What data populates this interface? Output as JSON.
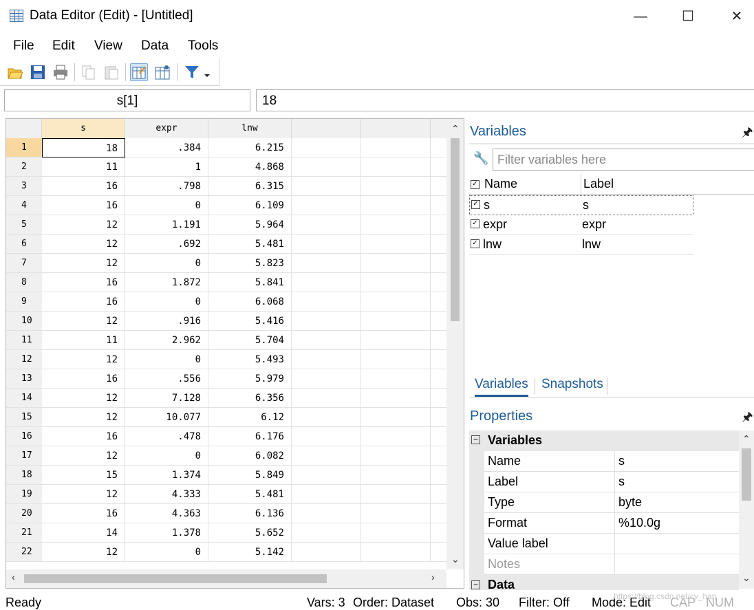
{
  "window": {
    "title": "Data Editor (Edit) - [Untitled]"
  },
  "menu": [
    "File",
    "Edit",
    "View",
    "Data",
    "Tools"
  ],
  "cell_ref": "s[1]",
  "cell_value": "18",
  "grid": {
    "columns": [
      "s",
      "expr",
      "lnw"
    ],
    "rows": [
      {
        "n": "1",
        "s": "18",
        "expr": ".384",
        "lnw": "6.215"
      },
      {
        "n": "2",
        "s": "11",
        "expr": "1",
        "lnw": "4.868"
      },
      {
        "n": "3",
        "s": "16",
        "expr": ".798",
        "lnw": "6.315"
      },
      {
        "n": "4",
        "s": "16",
        "expr": "0",
        "lnw": "6.109"
      },
      {
        "n": "5",
        "s": "12",
        "expr": "1.191",
        "lnw": "5.964"
      },
      {
        "n": "6",
        "s": "12",
        "expr": ".692",
        "lnw": "5.481"
      },
      {
        "n": "7",
        "s": "12",
        "expr": "0",
        "lnw": "5.823"
      },
      {
        "n": "8",
        "s": "16",
        "expr": "1.872",
        "lnw": "5.841"
      },
      {
        "n": "9",
        "s": "16",
        "expr": "0",
        "lnw": "6.068"
      },
      {
        "n": "10",
        "s": "12",
        "expr": ".916",
        "lnw": "5.416"
      },
      {
        "n": "11",
        "s": "11",
        "expr": "2.962",
        "lnw": "5.704"
      },
      {
        "n": "12",
        "s": "12",
        "expr": "0",
        "lnw": "5.493"
      },
      {
        "n": "13",
        "s": "16",
        "expr": ".556",
        "lnw": "5.979"
      },
      {
        "n": "14",
        "s": "12",
        "expr": "7.128",
        "lnw": "6.356"
      },
      {
        "n": "15",
        "s": "12",
        "expr": "10.077",
        "lnw": "6.12"
      },
      {
        "n": "16",
        "s": "16",
        "expr": ".478",
        "lnw": "6.176"
      },
      {
        "n": "17",
        "s": "12",
        "expr": "0",
        "lnw": "6.082"
      },
      {
        "n": "18",
        "s": "15",
        "expr": "1.374",
        "lnw": "5.849"
      },
      {
        "n": "19",
        "s": "12",
        "expr": "4.333",
        "lnw": "5.481"
      },
      {
        "n": "20",
        "s": "16",
        "expr": "4.363",
        "lnw": "6.136"
      },
      {
        "n": "21",
        "s": "14",
        "expr": "1.378",
        "lnw": "5.652"
      },
      {
        "n": "22",
        "s": "12",
        "expr": "0",
        "lnw": "5.142"
      }
    ]
  },
  "variables_pane": {
    "title": "Variables",
    "filter_placeholder": "Filter variables here",
    "headers": {
      "name": "Name",
      "label": "Label"
    },
    "items": [
      {
        "name": "s",
        "label": "s"
      },
      {
        "name": "expr",
        "label": "expr"
      },
      {
        "name": "lnw",
        "label": "lnw"
      }
    ]
  },
  "tabs": [
    "Variables",
    "Snapshots"
  ],
  "properties_pane": {
    "title": "Properties",
    "section": "Variables",
    "rows": [
      {
        "key": "Name",
        "value": "s"
      },
      {
        "key": "Label",
        "value": "s"
      },
      {
        "key": "Type",
        "value": "byte"
      },
      {
        "key": "Format",
        "value": "%10.0g"
      },
      {
        "key": "Value label",
        "value": ""
      },
      {
        "key": "Notes",
        "value": ""
      }
    ],
    "next_section": "Data"
  },
  "status": {
    "ready": "Ready",
    "vars": "Vars: 3",
    "order": "Order: Dataset",
    "obs": "Obs: 30",
    "filter": "Filter: Off",
    "mode": "Mode: Edit",
    "cap": "CAP",
    "num": "NUM"
  },
  "watermark": "https://blog.csdn.net/cy_han",
  "colors": {
    "accent": "#1f5c99",
    "selected_row": "#f9d8a0",
    "selected_col": "#fbe8c4"
  },
  "icons": [
    "open-icon",
    "save-icon",
    "print-icon",
    "copy-icon",
    "paste-icon",
    "edit-mode-icon",
    "browse-mode-icon",
    "filter-icon"
  ]
}
